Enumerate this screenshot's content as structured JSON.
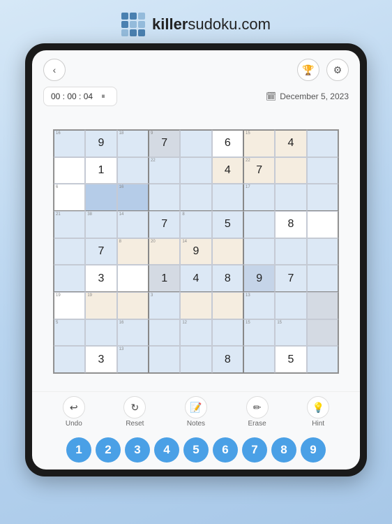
{
  "header": {
    "logo_text_bold": "killer",
    "logo_text_regular": "sudoku.com"
  },
  "toolbar": {
    "back_label": "‹",
    "trophy_icon": "🏆",
    "settings_icon": "⚙"
  },
  "timer": {
    "value": "00 : 00 : 04",
    "pause_icon": "⏸"
  },
  "date": {
    "icon": "📅",
    "value": "December 5, 2023"
  },
  "grid": {
    "cells": [
      {
        "row": 0,
        "col": 0,
        "val": "",
        "bg": "blue-light",
        "note": "16"
      },
      {
        "row": 0,
        "col": 1,
        "val": "9",
        "bg": "blue-light",
        "note": ""
      },
      {
        "row": 0,
        "col": 2,
        "val": "",
        "bg": "blue-light",
        "note": "18"
      },
      {
        "row": 0,
        "col": 3,
        "val": "7",
        "bg": "gray",
        "note": "9"
      },
      {
        "row": 0,
        "col": 4,
        "val": "",
        "bg": "blue-light",
        "note": ""
      },
      {
        "row": 0,
        "col": 5,
        "val": "6",
        "bg": "white",
        "note": ""
      },
      {
        "row": 0,
        "col": 6,
        "val": "",
        "bg": "cream",
        "note": "15"
      },
      {
        "row": 0,
        "col": 7,
        "val": "4",
        "bg": "cream",
        "note": ""
      },
      {
        "row": 0,
        "col": 8,
        "val": "",
        "bg": "blue-light",
        "note": ""
      },
      {
        "row": 1,
        "col": 0,
        "val": "",
        "bg": "white",
        "note": ""
      },
      {
        "row": 1,
        "col": 1,
        "val": "1",
        "bg": "white",
        "note": ""
      },
      {
        "row": 1,
        "col": 2,
        "val": "",
        "bg": "blue-light",
        "note": ""
      },
      {
        "row": 1,
        "col": 3,
        "val": "",
        "bg": "blue-light",
        "note": "22"
      },
      {
        "row": 1,
        "col": 4,
        "val": "",
        "bg": "blue-light",
        "note": ""
      },
      {
        "row": 1,
        "col": 5,
        "val": "4",
        "bg": "cream",
        "note": ""
      },
      {
        "row": 1,
        "col": 6,
        "val": "7",
        "bg": "cream",
        "note": "22"
      },
      {
        "row": 1,
        "col": 7,
        "val": "",
        "bg": "cream",
        "note": ""
      },
      {
        "row": 1,
        "col": 8,
        "val": "",
        "bg": "blue-light",
        "note": ""
      },
      {
        "row": 2,
        "col": 0,
        "val": "",
        "bg": "white",
        "note": "6"
      },
      {
        "row": 2,
        "col": 1,
        "val": "",
        "bg": "blue-dark",
        "note": ""
      },
      {
        "row": 2,
        "col": 2,
        "val": "",
        "bg": "blue-dark",
        "note": "16"
      },
      {
        "row": 2,
        "col": 3,
        "val": "",
        "bg": "blue-light",
        "note": ""
      },
      {
        "row": 2,
        "col": 4,
        "val": "",
        "bg": "blue-light",
        "note": ""
      },
      {
        "row": 2,
        "col": 5,
        "val": "",
        "bg": "blue-light",
        "note": ""
      },
      {
        "row": 2,
        "col": 6,
        "val": "",
        "bg": "blue-light",
        "note": "17"
      },
      {
        "row": 2,
        "col": 7,
        "val": "",
        "bg": "blue-light",
        "note": ""
      },
      {
        "row": 2,
        "col": 8,
        "val": "",
        "bg": "blue-light",
        "note": ""
      },
      {
        "row": 3,
        "col": 0,
        "val": "",
        "bg": "blue-light",
        "note": "21"
      },
      {
        "row": 3,
        "col": 1,
        "val": "",
        "bg": "blue-light",
        "note": "38"
      },
      {
        "row": 3,
        "col": 2,
        "val": "",
        "bg": "blue-light",
        "note": "14"
      },
      {
        "row": 3,
        "col": 3,
        "val": "7",
        "bg": "blue-light",
        "note": ""
      },
      {
        "row": 3,
        "col": 4,
        "val": "",
        "bg": "blue-light",
        "note": "8"
      },
      {
        "row": 3,
        "col": 5,
        "val": "5",
        "bg": "blue-light",
        "note": ""
      },
      {
        "row": 3,
        "col": 6,
        "val": "",
        "bg": "blue-light",
        "note": ""
      },
      {
        "row": 3,
        "col": 7,
        "val": "8",
        "bg": "white",
        "note": ""
      },
      {
        "row": 3,
        "col": 8,
        "val": "",
        "bg": "white",
        "note": ""
      },
      {
        "row": 4,
        "col": 0,
        "val": "",
        "bg": "blue-light",
        "note": ""
      },
      {
        "row": 4,
        "col": 1,
        "val": "7",
        "bg": "blue-light",
        "note": ""
      },
      {
        "row": 4,
        "col": 2,
        "val": "",
        "bg": "cream",
        "note": "8"
      },
      {
        "row": 4,
        "col": 3,
        "val": "",
        "bg": "cream",
        "note": "20"
      },
      {
        "row": 4,
        "col": 4,
        "val": "9",
        "bg": "cream",
        "note": "14"
      },
      {
        "row": 4,
        "col": 5,
        "val": "",
        "bg": "cream",
        "note": ""
      },
      {
        "row": 4,
        "col": 6,
        "val": "",
        "bg": "blue-light",
        "note": ""
      },
      {
        "row": 4,
        "col": 7,
        "val": "",
        "bg": "blue-light",
        "note": ""
      },
      {
        "row": 4,
        "col": 8,
        "val": "",
        "bg": "blue-light",
        "note": ""
      },
      {
        "row": 5,
        "col": 0,
        "val": "",
        "bg": "blue-light",
        "note": ""
      },
      {
        "row": 5,
        "col": 1,
        "val": "3",
        "bg": "white",
        "note": ""
      },
      {
        "row": 5,
        "col": 2,
        "val": "",
        "bg": "white",
        "note": ""
      },
      {
        "row": 5,
        "col": 3,
        "val": "1",
        "bg": "gray",
        "note": ""
      },
      {
        "row": 5,
        "col": 4,
        "val": "4",
        "bg": "blue-light",
        "note": ""
      },
      {
        "row": 5,
        "col": 5,
        "val": "8",
        "bg": "blue-light",
        "note": ""
      },
      {
        "row": 5,
        "col": 6,
        "val": "9",
        "bg": "highlighted",
        "note": ""
      },
      {
        "row": 5,
        "col": 7,
        "val": "7",
        "bg": "blue-light",
        "note": ""
      },
      {
        "row": 5,
        "col": 8,
        "val": "",
        "bg": "blue-light",
        "note": ""
      },
      {
        "row": 6,
        "col": 0,
        "val": "",
        "bg": "white",
        "note": "19"
      },
      {
        "row": 6,
        "col": 1,
        "val": "",
        "bg": "cream",
        "note": "19"
      },
      {
        "row": 6,
        "col": 2,
        "val": "",
        "bg": "cream",
        "note": ""
      },
      {
        "row": 6,
        "col": 3,
        "val": "",
        "bg": "blue-light",
        "note": "3"
      },
      {
        "row": 6,
        "col": 4,
        "val": "",
        "bg": "cream",
        "note": ""
      },
      {
        "row": 6,
        "col": 5,
        "val": "",
        "bg": "cream",
        "note": ""
      },
      {
        "row": 6,
        "col": 6,
        "val": "",
        "bg": "blue-light",
        "note": "13"
      },
      {
        "row": 6,
        "col": 7,
        "val": "",
        "bg": "blue-light",
        "note": ""
      },
      {
        "row": 6,
        "col": 8,
        "val": "",
        "bg": "gray",
        "note": ""
      },
      {
        "row": 7,
        "col": 0,
        "val": "",
        "bg": "blue-light",
        "note": "5"
      },
      {
        "row": 7,
        "col": 1,
        "val": "",
        "bg": "blue-light",
        "note": ""
      },
      {
        "row": 7,
        "col": 2,
        "val": "",
        "bg": "blue-light",
        "note": "16"
      },
      {
        "row": 7,
        "col": 3,
        "val": "",
        "bg": "blue-light",
        "note": ""
      },
      {
        "row": 7,
        "col": 4,
        "val": "",
        "bg": "blue-light",
        "note": "12"
      },
      {
        "row": 7,
        "col": 5,
        "val": "",
        "bg": "blue-light",
        "note": ""
      },
      {
        "row": 7,
        "col": 6,
        "val": "",
        "bg": "blue-light",
        "note": "15"
      },
      {
        "row": 7,
        "col": 7,
        "val": "",
        "bg": "blue-light",
        "note": "15"
      },
      {
        "row": 7,
        "col": 8,
        "val": "",
        "bg": "gray",
        "note": ""
      },
      {
        "row": 8,
        "col": 0,
        "val": "",
        "bg": "blue-light",
        "note": ""
      },
      {
        "row": 8,
        "col": 1,
        "val": "3",
        "bg": "white",
        "note": ""
      },
      {
        "row": 8,
        "col": 2,
        "val": "",
        "bg": "blue-light",
        "note": "13"
      },
      {
        "row": 8,
        "col": 3,
        "val": "",
        "bg": "blue-light",
        "note": ""
      },
      {
        "row": 8,
        "col": 4,
        "val": "",
        "bg": "blue-light",
        "note": ""
      },
      {
        "row": 8,
        "col": 5,
        "val": "8",
        "bg": "blue-light",
        "note": ""
      },
      {
        "row": 8,
        "col": 6,
        "val": "",
        "bg": "blue-light",
        "note": ""
      },
      {
        "row": 8,
        "col": 7,
        "val": "5",
        "bg": "white",
        "note": ""
      },
      {
        "row": 8,
        "col": 8,
        "val": "",
        "bg": "blue-light",
        "note": ""
      }
    ]
  },
  "tools": [
    {
      "id": "undo",
      "label": "Undo",
      "icon": "↩"
    },
    {
      "id": "reset",
      "label": "Reset",
      "icon": "↻"
    },
    {
      "id": "notes",
      "label": "Notes",
      "icon": "📝"
    },
    {
      "id": "erase",
      "label": "Erase",
      "icon": "✏"
    },
    {
      "id": "hint",
      "label": "Hint",
      "icon": "💡"
    }
  ],
  "numbers": [
    "1",
    "2",
    "3",
    "4",
    "5",
    "6",
    "7",
    "8",
    "9"
  ]
}
